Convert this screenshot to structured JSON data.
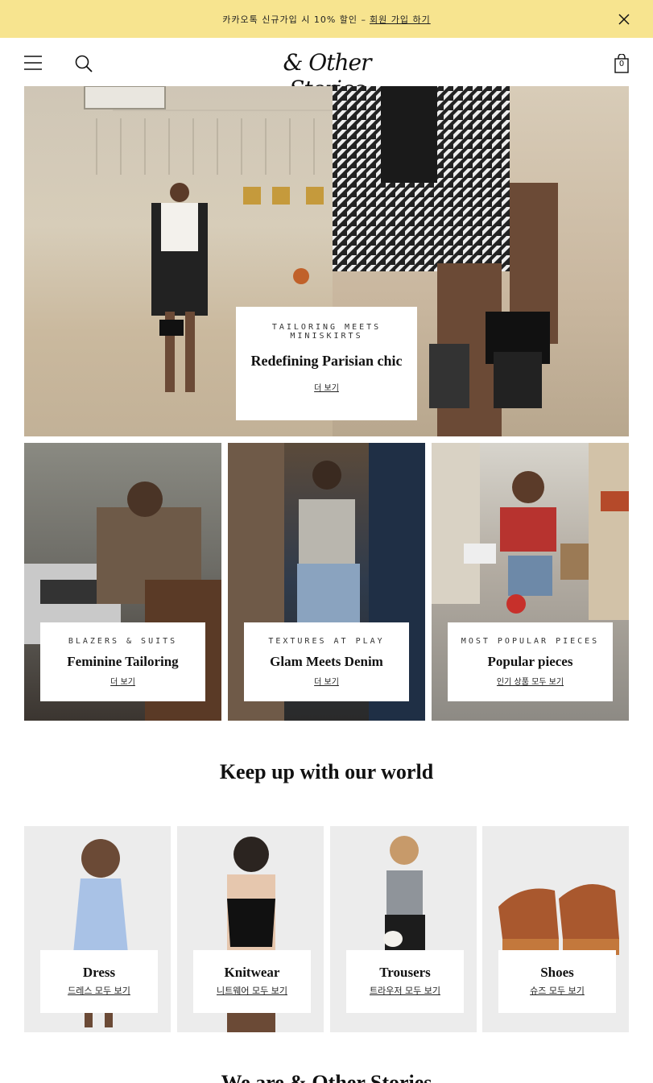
{
  "promo": {
    "text": "카카오톡 신규가입 시 10% 할인 –",
    "link": "회원 가입 하기"
  },
  "header": {
    "logo": "& Other Stories",
    "bag_count": "0"
  },
  "hero": {
    "eyebrow": "TAILORING MEETS MINISKIRTS",
    "title": "Redefining Parisian chic",
    "cta": "더 보기"
  },
  "tiles": [
    {
      "eyebrow": "BLAZERS & SUITS",
      "title": "Feminine Tailoring",
      "cta": "더 보기"
    },
    {
      "eyebrow": "TEXTURES AT PLAY",
      "title": "Glam Meets Denim",
      "cta": "더 보기"
    },
    {
      "eyebrow": "MOST POPULAR PIECES",
      "title": "Popular pieces",
      "cta": "인기 상품 모두 보기"
    }
  ],
  "world": {
    "title": "Keep up with our world"
  },
  "categories": [
    {
      "title": "Dress",
      "cta": "드레스 모두 보기"
    },
    {
      "title": "Knitwear",
      "cta": "니트웨어 모두 보기"
    },
    {
      "title": "Trousers",
      "cta": "트라우저 모두 보기"
    },
    {
      "title": "Shoes",
      "cta": "슈즈 모두 보기"
    }
  ],
  "about": {
    "title": "We are & Other Stories"
  },
  "colors": {
    "promo_bg": "#f7e48f"
  }
}
